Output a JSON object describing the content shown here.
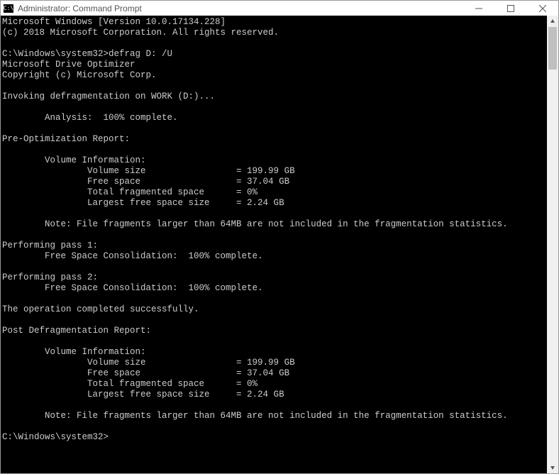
{
  "window": {
    "title": "Administrator: Command Prompt",
    "icon_label": "C:\\"
  },
  "console": {
    "lines": [
      "Microsoft Windows [Version 10.0.17134.228]",
      "(c) 2018 Microsoft Corporation. All rights reserved.",
      "",
      "C:\\Windows\\system32>defrag D: /U",
      "Microsoft Drive Optimizer",
      "Copyright (c) Microsoft Corp.",
      "",
      "Invoking defragmentation on WORK (D:)...",
      "",
      "        Analysis:  100% complete.",
      "",
      "Pre-Optimization Report:",
      "",
      "        Volume Information:",
      "                Volume size                 = 199.99 GB",
      "                Free space                  = 37.04 GB",
      "                Total fragmented space      = 0%",
      "                Largest free space size     = 2.24 GB",
      "",
      "        Note: File fragments larger than 64MB are not included in the fragmentation statistics.",
      "",
      "Performing pass 1:",
      "        Free Space Consolidation:  100% complete.",
      "",
      "Performing pass 2:",
      "        Free Space Consolidation:  100% complete.",
      "",
      "The operation completed successfully.",
      "",
      "Post Defragmentation Report:",
      "",
      "        Volume Information:",
      "                Volume size                 = 199.99 GB",
      "                Free space                  = 37.04 GB",
      "                Total fragmented space      = 0%",
      "                Largest free space size     = 2.24 GB",
      "",
      "        Note: File fragments larger than 64MB are not included in the fragmentation statistics.",
      "",
      "C:\\Windows\\system32>"
    ]
  }
}
